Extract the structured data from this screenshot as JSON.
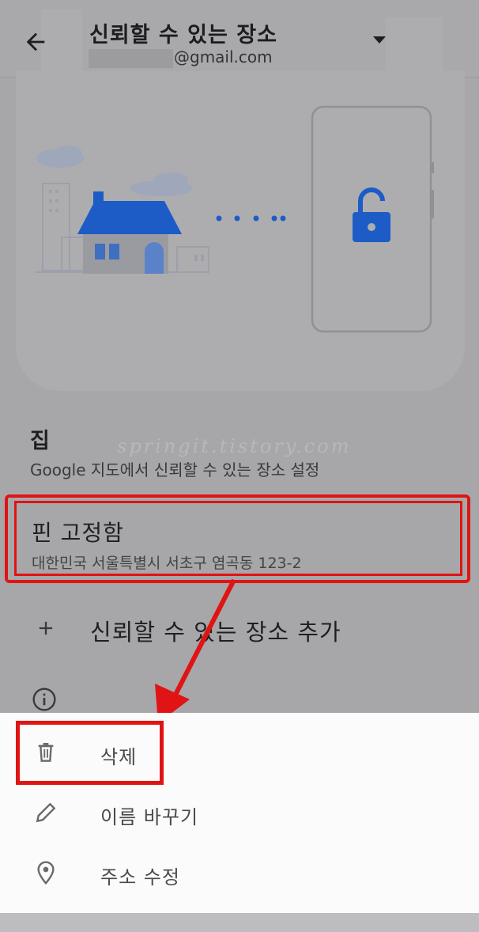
{
  "header": {
    "title": "신뢰할 수 있는 장소",
    "email_suffix": "@gmail.com"
  },
  "illustration": {
    "accent_color": "#1d5cc7",
    "icons": [
      "house-icon",
      "lock-icon",
      "phone-icon",
      "cloud-icon"
    ]
  },
  "watermark": "springit.tistory.com",
  "places": {
    "home_title": "집",
    "home_subtitle": "Google 지도에서 신뢰할 수 있는 장소 설정",
    "pinned_title": "핀 고정함",
    "pinned_address": "대한민국 서울특별시 서초구 염곡동 123-2",
    "add_label": "신뢰할 수 있는 장소 추가"
  },
  "sheet": {
    "items": [
      {
        "label": "삭제",
        "icon": "trash-icon"
      },
      {
        "label": "이름 바꾸기",
        "icon": "pencil-icon"
      },
      {
        "label": "주소 수정",
        "icon": "location-pin-icon"
      }
    ]
  },
  "annotation_color": "#e01414"
}
